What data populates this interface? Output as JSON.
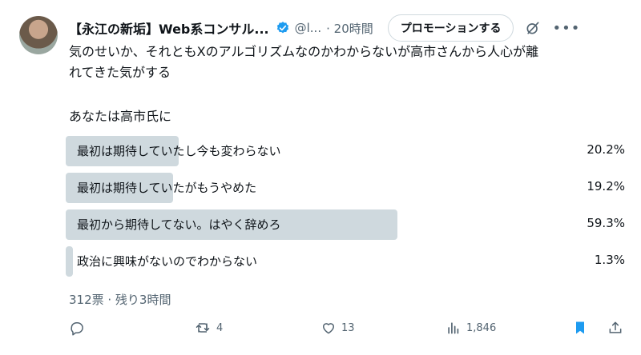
{
  "tweet": {
    "author_name": "【永江の新垢】Web系コンサル...",
    "handle": "@l...",
    "time": "· 20時間",
    "promote_label": "プロモーションする",
    "text_line1": "気のせいか、それともXのアルゴリズムなのかわからないが高市さんから人心が離",
    "text_line2": "れてきた気がする",
    "question": "あなたは高市氏に"
  },
  "poll": {
    "options": [
      {
        "label": "最初は期待していたし今も変わらない",
        "percent_text": "20.2%",
        "percent": 20.2,
        "leading": false
      },
      {
        "label": "最初は期待していたがもうやめた",
        "percent_text": "19.2%",
        "percent": 19.2,
        "leading": false
      },
      {
        "label": "最初から期待してない。はやく辞めろ",
        "percent_text": "59.3%",
        "percent": 59.3,
        "leading": true
      },
      {
        "label": "政治に興味がないのでわからない",
        "percent_text": "1.3%",
        "percent": 1.3,
        "leading": false
      }
    ],
    "meta": "312票 · 残り3時間"
  },
  "actions": {
    "reply_count": "",
    "repost_count": "4",
    "like_count": "13",
    "views_count": "1,846"
  },
  "colors": {
    "bar": "#cfd9de",
    "accent": "#1d9bf0",
    "muted": "#536471"
  }
}
